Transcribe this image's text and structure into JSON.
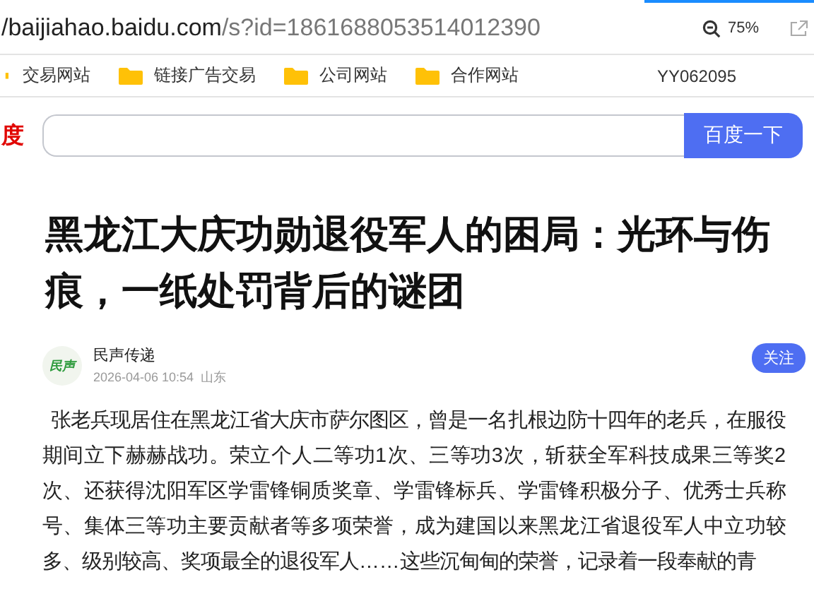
{
  "address_bar": {
    "host": "/baijiahao.baidu.com",
    "path": "/s?id=1861688053514012390",
    "zoom": "75%"
  },
  "bookmarks": [
    {
      "label": "交易网站"
    },
    {
      "label": "链接广告交易"
    },
    {
      "label": "公司网站"
    },
    {
      "label": "合作网站"
    }
  ],
  "bookmark_note": "YY062095",
  "search": {
    "logo": "度",
    "button": "百度一下"
  },
  "article": {
    "title": "黑龙江大庆功勋退役军人的困局：光环与伤痕，一纸处罚背后的谜团",
    "author": {
      "name": "民声传递",
      "avatar_text": "民声",
      "time": "2026-04-06 10:54",
      "location": "山东",
      "follow": "关注"
    },
    "paragraph": "张老兵现居住在黑龙江省大庆市萨尔图区，曾是一名扎根边防十四年的老兵，在服役期间立下赫赫战功。荣立个人二等功1次、三等功3次，斩获全军科技成果三等奖2次、还获得沈阳军区学雷锋铜质奖章、学雷锋标兵、学雷锋积极分子、优秀士兵称号、集体三等功主要贡献者等多项荣誉，成为建国以来黑龙江省退役军人中立功较多、级别较高、奖项最全的退役军人……这些沉甸甸的荣誉，记录着一段奉献的青"
  }
}
